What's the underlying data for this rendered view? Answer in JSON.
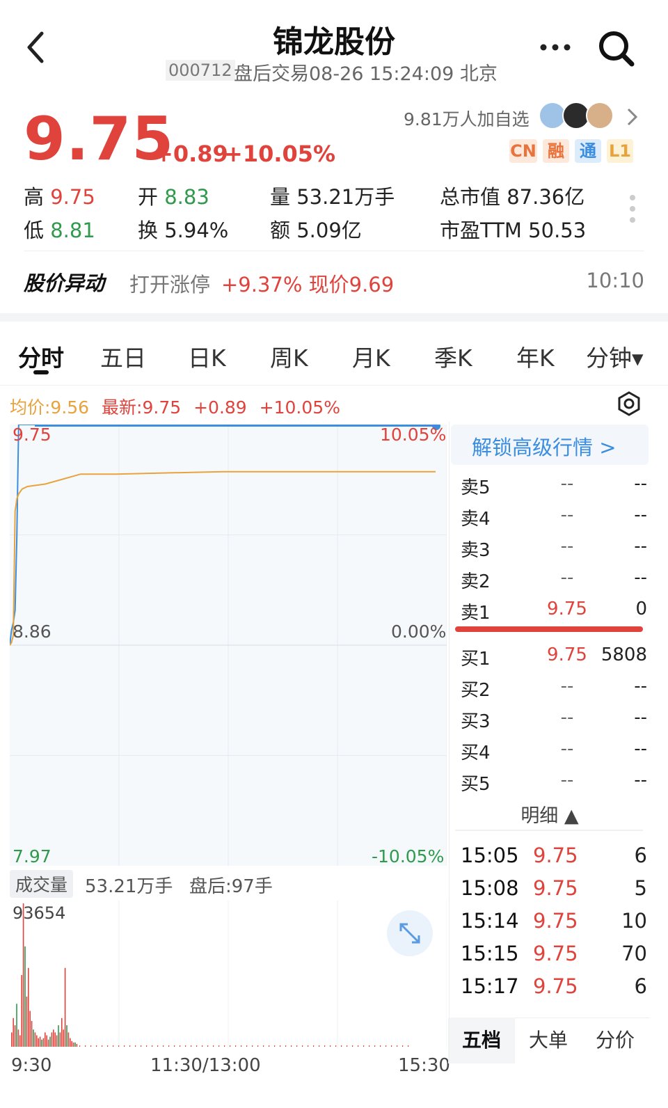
{
  "header": {
    "title": "锦龙股份",
    "code": "000712",
    "session": "盘后交易08-26 15:24:09 北京"
  },
  "quote": {
    "price": "9.75",
    "change": "+0.89",
    "change_pct": "+10.05%",
    "followers": "9.81万人加自选",
    "tags": [
      "CN",
      "融",
      "通",
      "L1"
    ],
    "high_label": "高",
    "high": "9.75",
    "open_label": "开",
    "open": "8.83",
    "volume_label": "量",
    "volume": "53.21万手",
    "mktcap_label": "总市值",
    "mktcap": "87.36亿",
    "low_label": "低",
    "low": "8.81",
    "turnover_label": "换",
    "turnover": "5.94%",
    "amount_label": "额",
    "amount": "5.09亿",
    "pe_label": "市盈TTM",
    "pe": "50.53"
  },
  "alert": {
    "label": "股价异动",
    "text": "打开涨停",
    "value": "+9.37% 现价9.69",
    "time": "10:10"
  },
  "tabs": [
    "分时",
    "五日",
    "日K",
    "周K",
    "月K",
    "季K",
    "年K",
    "分钟▾"
  ],
  "chart_header": {
    "avg": "均价:9.56",
    "latest": "最新:9.75",
    "change": "+0.89",
    "change_pct": "+10.05%"
  },
  "chart_labels": {
    "top_price": "9.75",
    "top_pct": "10.05%",
    "mid_price": "8.86",
    "mid_pct": "0.00%",
    "bot_price": "7.97",
    "bot_pct": "-10.05%"
  },
  "volume_bar": {
    "label": "成交量",
    "total": "53.21万手",
    "after_hours": "盘后:97手",
    "max": "93654"
  },
  "time_axis": [
    "9:30",
    "11:30/13:00",
    "15:30"
  ],
  "orderbook": {
    "unlock": "解锁高级行情 >",
    "asks": [
      {
        "label": "卖5",
        "price": "--",
        "vol": "--"
      },
      {
        "label": "卖4",
        "price": "--",
        "vol": "--"
      },
      {
        "label": "卖3",
        "price": "--",
        "vol": "--"
      },
      {
        "label": "卖2",
        "price": "--",
        "vol": "--"
      },
      {
        "label": "卖1",
        "price": "9.75",
        "vol": "0"
      }
    ],
    "bids": [
      {
        "label": "买1",
        "price": "9.75",
        "vol": "5808"
      },
      {
        "label": "买2",
        "price": "--",
        "vol": "--"
      },
      {
        "label": "买3",
        "price": "--",
        "vol": "--"
      },
      {
        "label": "买4",
        "price": "--",
        "vol": "--"
      },
      {
        "label": "买5",
        "price": "--",
        "vol": "--"
      }
    ],
    "detail_title": "明细 ▲",
    "details": [
      {
        "time": "15:05",
        "price": "9.75",
        "vol": "6"
      },
      {
        "time": "15:08",
        "price": "9.75",
        "vol": "5"
      },
      {
        "time": "15:14",
        "price": "9.75",
        "vol": "10"
      },
      {
        "time": "15:15",
        "price": "9.75",
        "vol": "70"
      },
      {
        "time": "15:17",
        "price": "9.75",
        "vol": "6"
      }
    ],
    "bottom_tabs": [
      "五档",
      "大单",
      "分价"
    ]
  },
  "colors": {
    "up": "#e0433c",
    "down": "#2f9a4c",
    "avg": "#e8a33d",
    "price_line": "#3b8de0"
  },
  "chart_data": {
    "type": "line",
    "ylim": [
      7.97,
      9.75
    ],
    "x": [
      "9:30",
      "9:31",
      "9:32",
      "9:33",
      "9:34",
      "9:35",
      "9:36",
      "9:37",
      "9:40",
      "9:50",
      "10:00",
      "10:10",
      "10:30",
      "11:30/13:00",
      "14:00",
      "15:00"
    ],
    "series": [
      {
        "values": [
          8.86,
          8.92,
          8.95,
          9.0,
          9.3,
          9.75,
          9.75,
          9.75,
          9.75,
          9.75,
          9.75,
          9.75,
          9.75,
          9.75,
          9.75,
          9.75
        ]
      },
      {
        "values": [
          8.86,
          8.87,
          8.9,
          9.4,
          9.45,
          9.47,
          9.48,
          9.49,
          9.5,
          9.51,
          9.53,
          9.55,
          9.55,
          9.56,
          9.56,
          9.56
        ]
      }
    ],
    "volume_max": 93654
  }
}
